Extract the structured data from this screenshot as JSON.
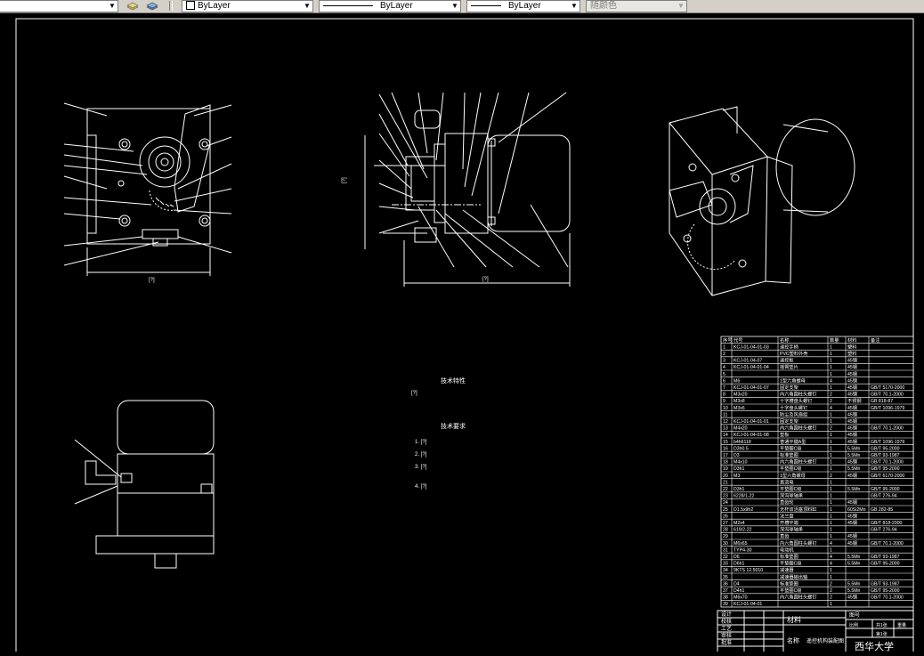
{
  "toolbar": {
    "layer_prev_arrow": "▼",
    "layer_color": "ByLayer",
    "linetype": "ByLayer",
    "lineweight": "ByLayer",
    "plot_style": "随颜色"
  },
  "drawing": {
    "views": {
      "front": {
        "dimension": "[?]"
      },
      "side": {
        "dimension": "[?]",
        "height_dim": "[?]"
      }
    },
    "technical_characteristics": {
      "heading": "技术特性",
      "body": "[?]"
    },
    "technical_requirements": {
      "heading": "技术要求",
      "items": [
        "1. [?]",
        "2. [?]",
        "3. [?]",
        "4. [?]"
      ]
    },
    "bom": {
      "columns": [
        "序号",
        "代号",
        "名称",
        "数量",
        "材料",
        "备注"
      ],
      "rows": [
        [
          "1",
          "KCJ-01-04-01-03",
          "遥控手柄",
          "1",
          "塑料",
          ""
        ],
        [
          "2",
          "",
          "PVC塑料外壳",
          "1",
          "塑料",
          ""
        ],
        [
          "3",
          "KCJ-01-04-07",
          "遥控板",
          "1",
          "45钢",
          ""
        ],
        [
          "4",
          "KCJ-01-04-01-04",
          "摇臂垫片",
          "1",
          "45钢",
          ""
        ],
        [
          "5",
          "",
          "",
          "1",
          "45钢",
          ""
        ],
        [
          "6",
          "M6",
          "1型六角螺母",
          "4",
          "45钢",
          ""
        ],
        [
          "7",
          "KCJ-01-04-01-07",
          "固定支架",
          "1",
          "45钢",
          "GB/T 5170-2000"
        ],
        [
          "8",
          "M3x20",
          "内六角圆柱头螺钉",
          "2",
          "45钢",
          "GB/T 70.1-2000"
        ],
        [
          "9",
          "M3x8",
          "十字槽盘头螺钉",
          "2",
          "不锈钢",
          "GB 818-87"
        ],
        [
          "10",
          "M3x6",
          "十字盘头螺钉",
          "4",
          "45钢",
          "GB/T 1096-1979"
        ],
        [
          "11",
          "",
          "防尘及风扇组",
          "1",
          "45钢",
          ""
        ],
        [
          "12",
          "KCJ-01-04-01-01",
          "固定支架",
          "1",
          "45钢",
          ""
        ],
        [
          "13",
          "M4x20",
          "内六角圆柱头螺钉",
          "2",
          "45钢",
          "GB/T 70.1-2000"
        ],
        [
          "14",
          "KCJ-01-04-01-08",
          "垫板",
          "1",
          "45钢",
          ""
        ],
        [
          "15",
          "b4h6118",
          "普通平键A型",
          "1",
          "45钢",
          "GB/T 1096-1979"
        ],
        [
          "16",
          "D3h0.5",
          "平垫圈C级",
          "1",
          "5.5Mn",
          "GB/T 95-2000"
        ],
        [
          "17",
          "D3",
          "标准垫圈",
          "1",
          "5.5Mn",
          "GB/T 93-1987"
        ],
        [
          "18",
          "M4x10",
          "内六角圆柱头螺钉",
          "1",
          "45钢",
          "GB/T 70.1-2000"
        ],
        [
          "19",
          "D3h1",
          "平垫圈C级",
          "1",
          "5.5Mn",
          "GB/T 95-2000"
        ],
        [
          "20",
          "M3",
          "1型六角螺母",
          "2",
          "45钢",
          "GB/T 6170-2000"
        ],
        [
          "21",
          "",
          "直流电",
          "1",
          "",
          ""
        ],
        [
          "22",
          "D3h1",
          "平垫圈C级",
          "1",
          "5.5Mn",
          "GB/T 95-2000"
        ],
        [
          "23",
          "6228/1-22",
          "深沟球轴承",
          "1",
          "",
          "GB/T 276-94"
        ],
        [
          "24",
          "",
          "直齿轮",
          "1",
          "45钢",
          ""
        ],
        [
          "25",
          "D1.5x9h2",
          "无杆双活塞顶料缸",
          "1",
          "60Si2Mn",
          "GB 282-85"
        ],
        [
          "26",
          "",
          "法兰盘",
          "1",
          "45钢",
          ""
        ],
        [
          "27",
          "M2x4",
          "开槽平端",
          "1",
          "45钢",
          "GB/T 818-2000"
        ],
        [
          "28",
          "619/2-22",
          "深沟球轴承",
          "1",
          "",
          "GB/T 276-94"
        ],
        [
          "29",
          "",
          "直齿",
          "1",
          "45钢",
          ""
        ],
        [
          "30",
          "M6x65",
          "内六角圆柱头螺钉",
          "4",
          "45钢",
          "GB/T 70.1-2000"
        ],
        [
          "31",
          "TYP4-30",
          "电动机",
          "1",
          "",
          ""
        ],
        [
          "32",
          "D6",
          "标准垫圈",
          "4",
          "5.5Mn",
          "GB/T 93-1987"
        ],
        [
          "33",
          "D6h1",
          "平垫圈C级",
          "4",
          "5.5Mn",
          "GB/T 95-2000"
        ],
        [
          "34",
          "9KTS 12.5010",
          "减速器",
          "1",
          "",
          ""
        ],
        [
          "35",
          "",
          "减速器输出轴",
          "1",
          "",
          ""
        ],
        [
          "36",
          "D4",
          "标准垫圈",
          "2",
          "5.5Mn",
          "GB/T 93-1987"
        ],
        [
          "37",
          "D4h1",
          "平垫圈C级",
          "2",
          "5.5Mn",
          "GB/T 95-2000"
        ],
        [
          "38",
          "M6x70",
          "内六角圆柱头螺钉",
          "2",
          "45钢",
          "GB/T 70.1-2000"
        ],
        [
          "39",
          "KCJ-01-04-01",
          "",
          "1",
          "",
          ""
        ]
      ]
    },
    "title_block": {
      "design": "设计",
      "check": "校核",
      "process": "工艺",
      "review": "审核",
      "approve": "批准",
      "material": "材料",
      "drawing_no": "图号",
      "name_label": "名称",
      "name": "遥控机构装配图",
      "school": "西华大学",
      "scale": "比例",
      "sheet": "第1张",
      "total": "共1张",
      "weight": "重量",
      "quantity": "数量"
    }
  }
}
